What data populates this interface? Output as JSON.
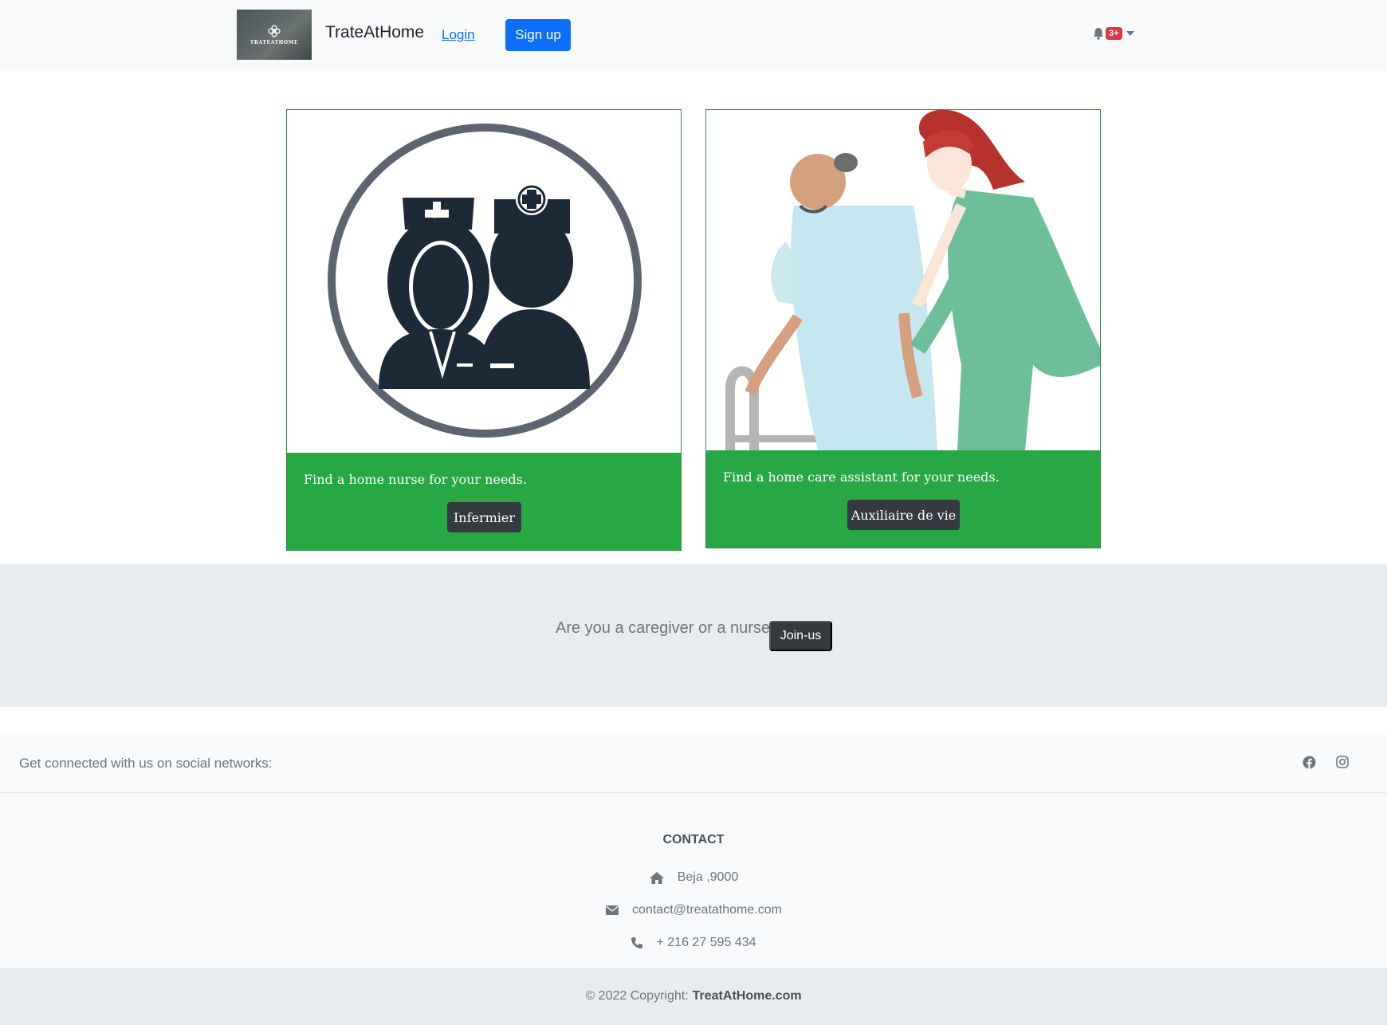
{
  "navbar": {
    "logo_text": "TRATEATHOME",
    "brand": "TrateAtHome",
    "login_label": "Login",
    "signup_label": "Sign up",
    "notification_count": "3+"
  },
  "cards": [
    {
      "text": "Find a home nurse for your needs.",
      "button_label": "Infermier",
      "image": "nurse-and-doctor-illustration"
    },
    {
      "text": "Find a home care assistant for your needs.",
      "button_label": "Auxiliaire de vie",
      "image": "caregiver-helping-elderly-man-illustration"
    }
  ],
  "join": {
    "text": "Are you a caregiver or a nurse?",
    "button_label": "Join-us"
  },
  "footer": {
    "social_text": "Get connected with us on social networks:",
    "contact_title": "CONTACT",
    "address": "Beja ,9000",
    "email": "contact@treatathome.com",
    "phone": "+ 216 27 595 434",
    "copyright_prefix": "© 2022 Copyright:",
    "copyright_brand": "TreatAtHome.com"
  },
  "colors": {
    "primary": "#0d6efd",
    "success": "#28a745",
    "dark": "#343a40",
    "danger": "#dc3545"
  }
}
